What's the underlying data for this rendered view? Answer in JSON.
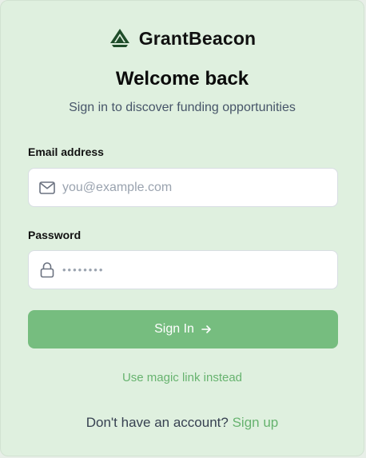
{
  "brand": {
    "name": "GrantBeacon",
    "icon": "mountain-logo-icon",
    "color": "#1f4d2a"
  },
  "header": {
    "title": "Welcome back",
    "subtitle": "Sign in to discover funding opportunities"
  },
  "form": {
    "email": {
      "label": "Email address",
      "placeholder": "you@example.com",
      "value": "",
      "icon": "mail-icon"
    },
    "password": {
      "label": "Password",
      "placeholder": "",
      "value": "••••••••",
      "icon": "lock-icon"
    },
    "submit_label": "Sign In",
    "submit_icon": "arrow-right-icon",
    "magic_link_label": "Use magic link instead"
  },
  "footer": {
    "prompt": "Don't have an account?",
    "signup_label": "Sign up"
  },
  "colors": {
    "accent": "#76bd7f",
    "link": "#67b36f",
    "background": "#dff0df"
  }
}
